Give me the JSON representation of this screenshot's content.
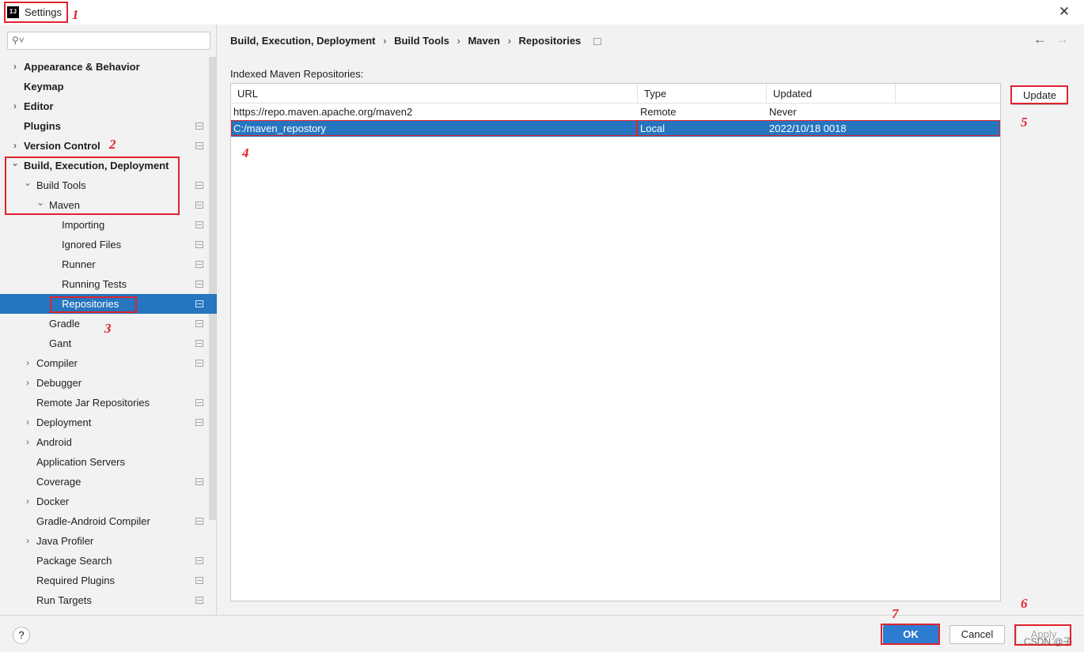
{
  "window": {
    "title": "Settings",
    "close_label": "✕"
  },
  "search": {
    "placeholder": ""
  },
  "sidebar": {
    "items": [
      {
        "label": "Appearance & Behavior",
        "expander": "›"
      },
      {
        "label": "Keymap"
      },
      {
        "label": "Editor",
        "expander": "›"
      },
      {
        "label": "Plugins"
      },
      {
        "label": "Version Control",
        "expander": "›"
      },
      {
        "label": "Build, Execution, Deployment",
        "expander": "⌄"
      },
      {
        "label": "Build Tools",
        "expander": "⌄"
      },
      {
        "label": "Maven",
        "expander": "⌄"
      },
      {
        "label": "Importing"
      },
      {
        "label": "Ignored Files"
      },
      {
        "label": "Runner"
      },
      {
        "label": "Running Tests"
      },
      {
        "label": "Repositories"
      },
      {
        "label": "Gradle"
      },
      {
        "label": "Gant"
      },
      {
        "label": "Compiler",
        "expander": "›"
      },
      {
        "label": "Debugger",
        "expander": "›"
      },
      {
        "label": "Remote Jar Repositories"
      },
      {
        "label": "Deployment",
        "expander": "›"
      },
      {
        "label": "Android",
        "expander": "›"
      },
      {
        "label": "Application Servers"
      },
      {
        "label": "Coverage"
      },
      {
        "label": "Docker",
        "expander": "›"
      },
      {
        "label": "Gradle-Android Compiler"
      },
      {
        "label": "Java Profiler",
        "expander": "›"
      },
      {
        "label": "Package Search"
      },
      {
        "label": "Required Plugins"
      },
      {
        "label": "Run Targets"
      }
    ]
  },
  "breadcrumb": [
    "Build, Execution, Deployment",
    "Build Tools",
    "Maven",
    "Repositories"
  ],
  "breadcrumb_sep": "›",
  "nav": {
    "back": "←",
    "forward": "→"
  },
  "main": {
    "section_label": "Indexed Maven Repositories:",
    "columns": [
      "URL",
      "Type",
      "Updated"
    ],
    "rows": [
      {
        "url": "https://repo.maven.apache.org/maven2",
        "type": "Remote",
        "updated": "Never"
      },
      {
        "url": "C:/maven_repostory",
        "type": "Local",
        "updated": "2022/10/18 0018"
      }
    ],
    "update_button": "Update"
  },
  "footer": {
    "help_label": "?",
    "ok_label": "OK",
    "cancel_label": "Cancel",
    "apply_label": "Apply",
    "watermark": "CSDN @子"
  },
  "annotations": [
    "1",
    "2",
    "3",
    "4",
    "5",
    "6",
    "7"
  ],
  "colors": {
    "selection": "#2675bf",
    "annotation_red": "#e0232e",
    "ok_blue": "#2d7cd0"
  }
}
